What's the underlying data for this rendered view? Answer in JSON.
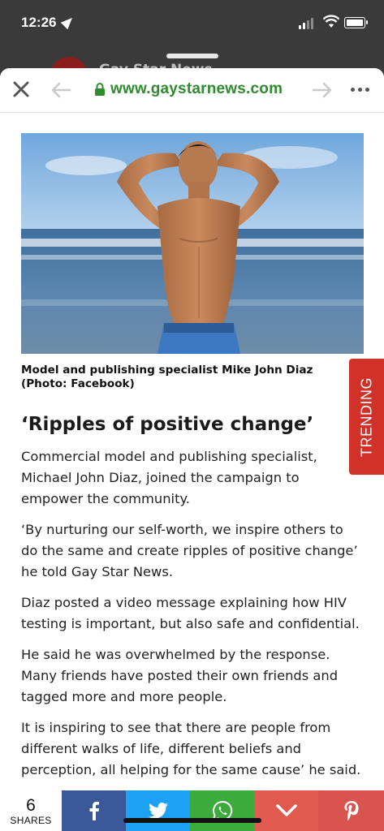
{
  "status": {
    "time": "12:26"
  },
  "background_page": {
    "title": "Gay Star News"
  },
  "browser": {
    "url": "www.gaystarnews.com"
  },
  "article": {
    "caption": "Model and publishing specialist Mike John Diaz (Photo: Facebook)",
    "heading": "‘Ripples of positive change’",
    "paragraphs": [
      "Commercial model and publishing specialist, Michael John Diaz, joined the campaign to empower the community.",
      "‘By nurturing our self-worth, we inspire others to do the same and create ripples of positive change’ he told Gay Star News.",
      "Diaz posted a video message explaining how HIV testing is important, but also safe and confidential.",
      "He said he was overwhelmed by the response. Many friends have posted their own friends and tagged more and more people.",
      "It is inspiring to see that there are people from different walks of life, different beliefs and perception, all helping for the same cause’ he said."
    ]
  },
  "trending": {
    "label": "TRENDING"
  },
  "share": {
    "count": "6",
    "label": "SHARES",
    "buttons": [
      {
        "name": "facebook",
        "icon": "facebook-icon",
        "color": "#3b5998"
      },
      {
        "name": "twitter",
        "icon": "twitter-icon",
        "color": "#1da1f2"
      },
      {
        "name": "whatsapp",
        "icon": "whatsapp-icon",
        "color": "#3cab3c"
      },
      {
        "name": "more",
        "icon": "chevron-down-icon",
        "color": "#e05a4f"
      },
      {
        "name": "pinterest",
        "icon": "pinterest-icon",
        "color": "#d9534f"
      }
    ]
  }
}
